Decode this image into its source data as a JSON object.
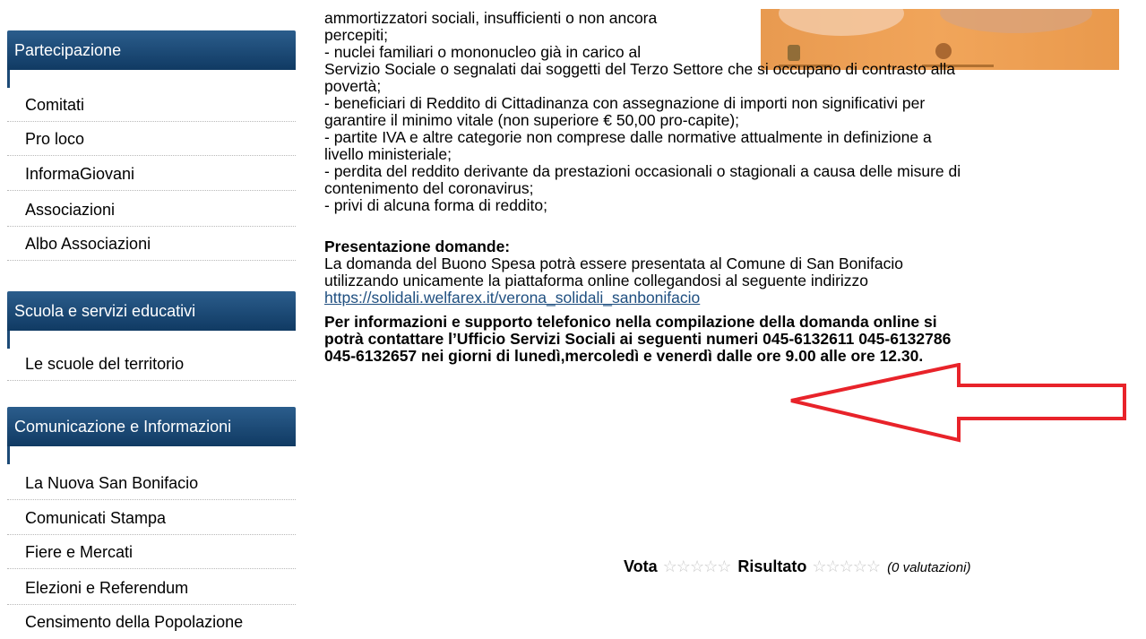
{
  "sidebar": {
    "sections": [
      {
        "title": "Partecipazione",
        "items": [
          "Comitati",
          "Pro loco",
          "InformaGiovani",
          "Associazioni",
          "Albo Associazioni"
        ]
      },
      {
        "title": "Scuola e servizi educativi",
        "items": [
          "Le scuole del territorio"
        ]
      },
      {
        "title": "Comunicazione e Informazioni",
        "items": [
          "La Nuova San Bonifacio",
          "Comunicati Stampa",
          "Fiere e Mercati",
          "Elezioni e Referendum",
          "Censimento della Popolazione"
        ]
      }
    ]
  },
  "content": {
    "lines": [
      "ammortizzatori sociali, insufficienti o non ancora",
      "percepiti;",
      "- nuclei familiari o mononucleo già in carico al",
      "Servizio Sociale o segnalati dai soggetti del Terzo Settore che si occupano di contrasto alla",
      "povertà;",
      "- beneficiari di Reddito di Cittadinanza con assegnazione di importi non significativi per",
      "garantire il minimo vitale (non superiore  € 50,00 pro-capite);",
      "- partite IVA e altre categorie non comprese dalle normative attualmente in definizione a",
      "livello ministeriale;",
      "- perdita del reddito derivante da prestazioni occasionali o stagionali a causa delle misure di",
      "contenimento del coronavirus;",
      "- privi di alcuna forma di reddito;"
    ],
    "presentation_title": "Presentazione domande:",
    "presentation_lines": [
      "La domanda del Buono Spesa potrà essere  presentata al Comune di San Bonifacio",
      "utilizzando unicamente la piattaforma online collegandosi al seguente indirizzo"
    ],
    "link": "https://solidali.welfarex.it/verona_solidali_sanbonifacio",
    "info_lines": [
      "Per informazioni e supporto telefonico nella compilazione della domanda online si",
      "potrà contattare l’Ufficio Servizi Sociali ai seguenti numeri 045-6132611  045-6132786",
      "045-6132657 nei giorni di lunedì,mercoledì e venerdì dalle ore 9.00 alle ore 12.30."
    ]
  },
  "rating": {
    "vota_label": "Vota",
    "risultato_label": "Risultato",
    "count_text": "(0 valutazioni)",
    "stars": "☆☆☆☆☆"
  },
  "colors": {
    "sidebar_header": "#1c4a76",
    "link": "#1f4f80",
    "arrow": "#e8232a",
    "banner": "#ef9f55"
  }
}
